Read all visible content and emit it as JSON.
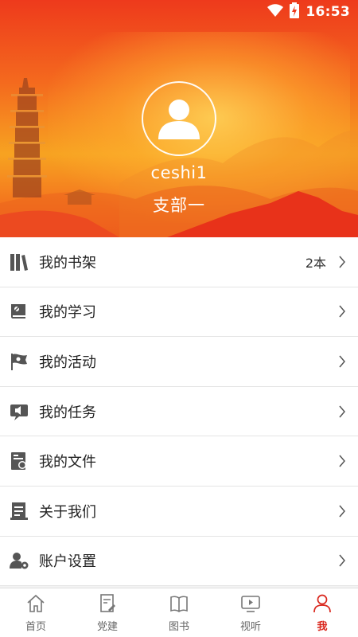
{
  "status_bar": {
    "time": "16:53"
  },
  "profile": {
    "username": "ceshi1",
    "branch": "支部一"
  },
  "menu": [
    {
      "label": "我的书架",
      "value": "2本",
      "icon": "bookshelf-icon"
    },
    {
      "label": "我的学习",
      "value": "",
      "icon": "study-book-icon"
    },
    {
      "label": "我的活动",
      "value": "",
      "icon": "party-flag-icon"
    },
    {
      "label": "我的任务",
      "value": "",
      "icon": "task-announce-icon"
    },
    {
      "label": "我的文件",
      "value": "",
      "icon": "file-document-icon"
    },
    {
      "label": "关于我们",
      "value": "",
      "icon": "about-notebook-icon"
    },
    {
      "label": "账户设置",
      "value": "",
      "icon": "account-settings-icon"
    }
  ],
  "tabs": [
    {
      "label": "首页",
      "icon": "home-icon",
      "active": false
    },
    {
      "label": "党建",
      "icon": "party-build-icon",
      "active": false
    },
    {
      "label": "图书",
      "icon": "book-icon",
      "active": false
    },
    {
      "label": "视听",
      "icon": "video-icon",
      "active": false
    },
    {
      "label": "我",
      "icon": "person-icon",
      "active": true
    }
  ],
  "colors": {
    "accent": "#d9261c",
    "icon_gray": "#555555",
    "hero_top": "#ee3a1c",
    "hero_mid": "#f7a321"
  }
}
